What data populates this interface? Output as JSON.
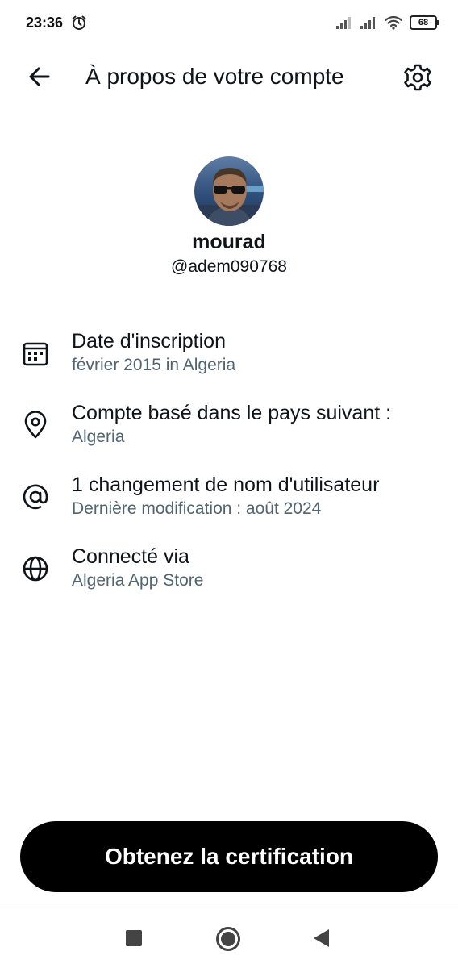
{
  "status_bar": {
    "time": "23:36",
    "battery": "68"
  },
  "header": {
    "title": "À propos de votre compte"
  },
  "profile": {
    "name": "mourad",
    "handle": "@adem090768"
  },
  "info": [
    {
      "icon": "calendar-icon",
      "title": "Date d'inscription",
      "subtitle": "février 2015 in Algeria"
    },
    {
      "icon": "location-pin-icon",
      "title": "Compte basé dans le pays suivant :",
      "subtitle": "Algeria"
    },
    {
      "icon": "at-sign-icon",
      "title": "1 changement de nom d'utilisateur",
      "subtitle": "Dernière modification : août 2024"
    },
    {
      "icon": "globe-icon",
      "title": "Connecté via",
      "subtitle": "Algeria App Store"
    }
  ],
  "cta": {
    "label": "Obtenez la certification"
  },
  "colors": {
    "primary_text": "#0f1419",
    "secondary_text": "#536471",
    "button_bg": "#000000",
    "button_text": "#ffffff"
  }
}
